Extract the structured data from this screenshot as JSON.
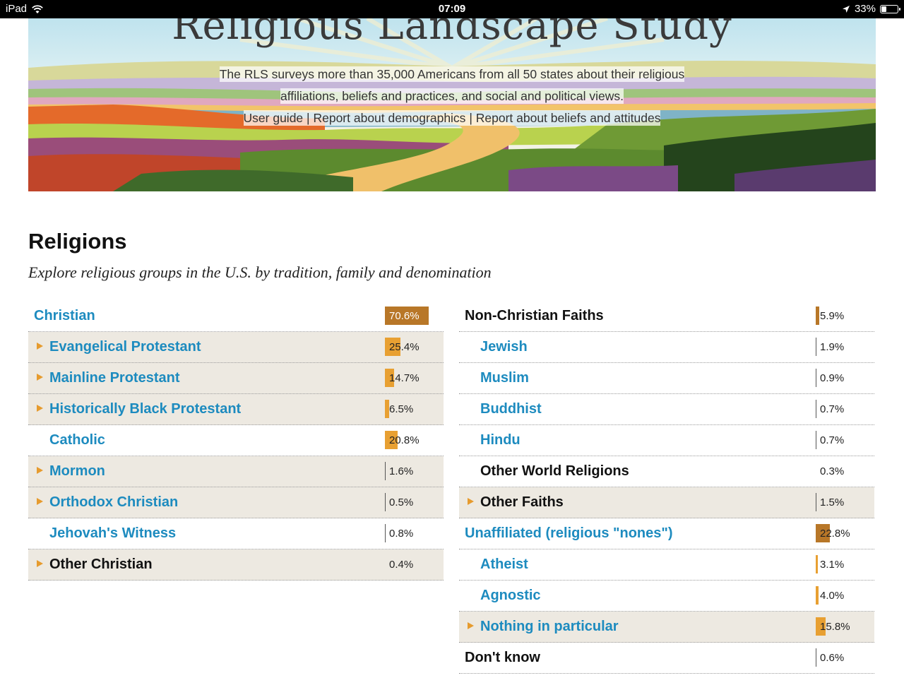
{
  "status_bar": {
    "device": "iPad",
    "time": "07:09",
    "battery": "33%",
    "battery_level": 0.33
  },
  "banner": {
    "title": "Religious Landscape Study",
    "description_line1": "The RLS surveys more than 35,000 Americans from all 50 states about their religious",
    "description_line2": "affiliations, beliefs and practices, and social and political views.",
    "links": [
      "User guide",
      "Report about demographics",
      "Report about beliefs and attitudes"
    ],
    "separator": "|"
  },
  "section": {
    "title": "Religions",
    "subtitle": "Explore religious groups in the U.S. by tradition, family and denomination"
  },
  "left_column": [
    {
      "label": "Christian",
      "value": 70.6,
      "pct": "70.6%",
      "level": 0,
      "expandable": false,
      "link": true,
      "shaded": false,
      "dark": true
    },
    {
      "label": "Evangelical Protestant",
      "value": 25.4,
      "pct": "25.4%",
      "level": 1,
      "expandable": true,
      "link": true,
      "shaded": true
    },
    {
      "label": "Mainline Protestant",
      "value": 14.7,
      "pct": "14.7%",
      "level": 1,
      "expandable": true,
      "link": true,
      "shaded": true
    },
    {
      "label": "Historically Black Protestant",
      "value": 6.5,
      "pct": "6.5%",
      "level": 1,
      "expandable": true,
      "link": true,
      "shaded": true
    },
    {
      "label": "Catholic",
      "value": 20.8,
      "pct": "20.8%",
      "level": 1,
      "expandable": false,
      "link": true,
      "shaded": false
    },
    {
      "label": "Mormon",
      "value": 1.6,
      "pct": "1.6%",
      "level": 1,
      "expandable": true,
      "link": true,
      "shaded": true
    },
    {
      "label": "Orthodox Christian",
      "value": 0.5,
      "pct": "0.5%",
      "level": 1,
      "expandable": true,
      "link": true,
      "shaded": true
    },
    {
      "label": "Jehovah's Witness",
      "value": 0.8,
      "pct": "0.8%",
      "level": 1,
      "expandable": false,
      "link": true,
      "shaded": false
    },
    {
      "label": "Other Christian",
      "value": 0.4,
      "pct": "0.4%",
      "level": 1,
      "expandable": true,
      "link": false,
      "shaded": true,
      "nobar": true
    }
  ],
  "right_column": [
    {
      "label": "Non-Christian Faiths",
      "value": 5.9,
      "pct": "5.9%",
      "level": 0,
      "expandable": false,
      "link": false,
      "shaded": false,
      "dark": true
    },
    {
      "label": "Jewish",
      "value": 1.9,
      "pct": "1.9%",
      "level": 1,
      "expandable": false,
      "link": true,
      "shaded": false
    },
    {
      "label": "Muslim",
      "value": 0.9,
      "pct": "0.9%",
      "level": 1,
      "expandable": false,
      "link": true,
      "shaded": false
    },
    {
      "label": "Buddhist",
      "value": 0.7,
      "pct": "0.7%",
      "level": 1,
      "expandable": false,
      "link": true,
      "shaded": false
    },
    {
      "label": "Hindu",
      "value": 0.7,
      "pct": "0.7%",
      "level": 1,
      "expandable": false,
      "link": true,
      "shaded": false
    },
    {
      "label": "Other World Religions",
      "value": 0.3,
      "pct": "0.3%",
      "level": 1,
      "expandable": false,
      "link": false,
      "shaded": false,
      "nobar": true
    },
    {
      "label": "Other Faiths",
      "value": 1.5,
      "pct": "1.5%",
      "level": 1,
      "expandable": true,
      "link": false,
      "shaded": true
    },
    {
      "label": "Unaffiliated (religious \"nones\")",
      "value": 22.8,
      "pct": "22.8%",
      "level": 0,
      "expandable": false,
      "link": true,
      "shaded": false,
      "dark": true
    },
    {
      "label": "Atheist",
      "value": 3.1,
      "pct": "3.1%",
      "level": 1,
      "expandable": false,
      "link": true,
      "shaded": false
    },
    {
      "label": "Agnostic",
      "value": 4.0,
      "pct": "4.0%",
      "level": 1,
      "expandable": false,
      "link": true,
      "shaded": false
    },
    {
      "label": "Nothing in particular",
      "value": 15.8,
      "pct": "15.8%",
      "level": 1,
      "expandable": true,
      "link": true,
      "shaded": true
    },
    {
      "label": "Don't know",
      "value": 0.6,
      "pct": "0.6%",
      "level": 0,
      "expandable": false,
      "link": false,
      "shaded": false
    }
  ],
  "colors": {
    "link": "#1d8bbf",
    "bar": "#e8a032",
    "bar_dark": "#b87728",
    "expand_arrow": "#e69b2e",
    "shaded_row": "#ede9e1"
  },
  "icons": {
    "wifi": "wifi-icon",
    "location": "location-arrow-icon",
    "battery": "battery-icon",
    "expand": "triangle-right-icon"
  }
}
